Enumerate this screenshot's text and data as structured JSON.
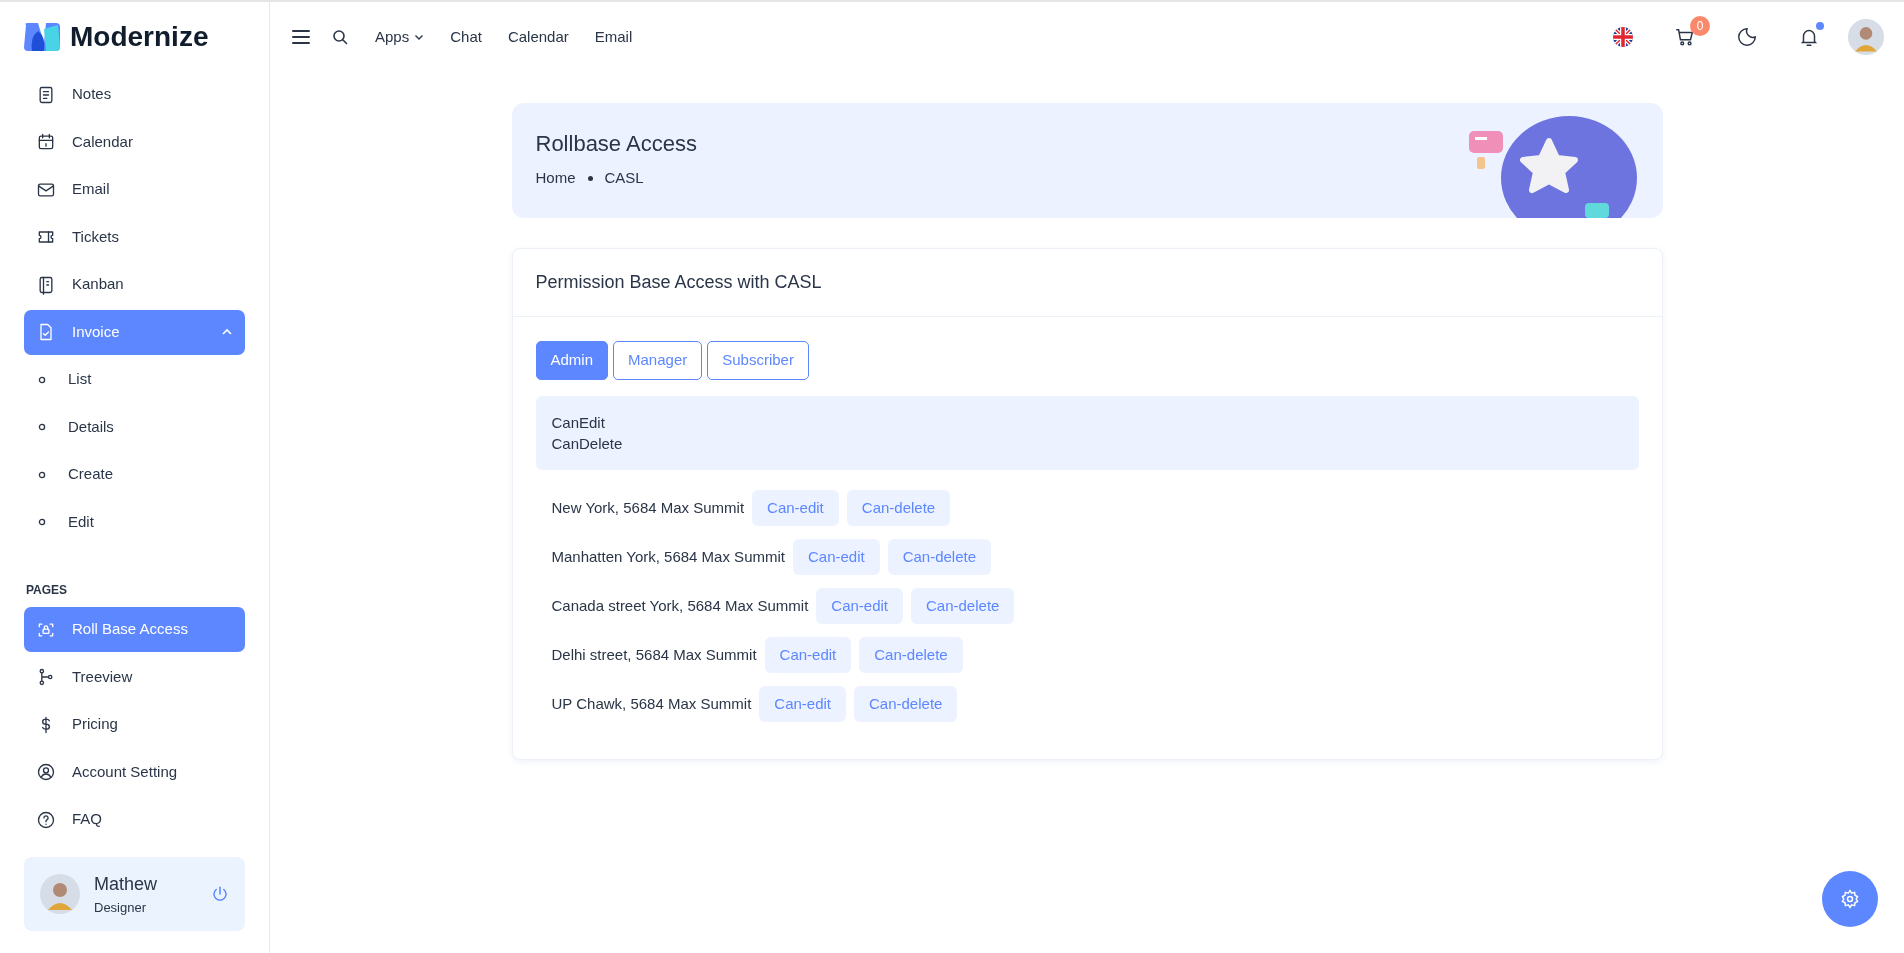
{
  "brand": {
    "name": "Modernize"
  },
  "sidebar": {
    "items": [
      {
        "label": "Notes",
        "selected": false
      },
      {
        "label": "Calendar",
        "selected": false
      },
      {
        "label": "Email",
        "selected": false
      },
      {
        "label": "Tickets",
        "selected": false
      },
      {
        "label": "Kanban",
        "selected": false
      },
      {
        "label": "Invoice",
        "selected": true,
        "expanded": true,
        "children": [
          {
            "label": "List",
            "selected": false
          },
          {
            "label": "Details",
            "selected": false
          },
          {
            "label": "Create",
            "selected": false
          },
          {
            "label": "Edit",
            "selected": false
          }
        ]
      }
    ],
    "section": "PAGES",
    "pages": [
      {
        "label": "Roll Base Access",
        "selected": true
      },
      {
        "label": "Treeview",
        "selected": false
      },
      {
        "label": "Pricing",
        "selected": false
      },
      {
        "label": "Account Setting",
        "selected": false
      },
      {
        "label": "FAQ",
        "selected": false
      }
    ],
    "profile": {
      "name": "Mathew",
      "role": "Designer"
    }
  },
  "topbar": {
    "links": [
      {
        "label": "Apps",
        "dropdown": true
      },
      {
        "label": "Chat",
        "dropdown": false
      },
      {
        "label": "Calendar",
        "dropdown": false
      },
      {
        "label": "Email",
        "dropdown": false
      }
    ],
    "cart_count": "0"
  },
  "header": {
    "title": "Rollbase Access",
    "breadcrumb": [
      "Home",
      "CASL"
    ]
  },
  "card": {
    "title": "Permission Base Access with CASL",
    "roles": [
      {
        "label": "Admin",
        "selected": true
      },
      {
        "label": "Manager",
        "selected": false
      },
      {
        "label": "Subscriber",
        "selected": false
      }
    ],
    "permissions": [
      "CanEdit",
      "CanDelete"
    ],
    "rows": [
      {
        "text": "New York, 5684 Max Summit",
        "actions": [
          "Can-edit",
          "Can-delete"
        ]
      },
      {
        "text": "Manhatten York, 5684 Max Summit",
        "actions": [
          "Can-edit",
          "Can-delete"
        ]
      },
      {
        "text": "Canada street York, 5684 Max Summit",
        "actions": [
          "Can-edit",
          "Can-delete"
        ]
      },
      {
        "text": "Delhi street, 5684 Max Summit",
        "actions": [
          "Can-edit",
          "Can-delete"
        ]
      },
      {
        "text": "UP Chawk, 5684 Max Summit",
        "actions": [
          "Can-edit",
          "Can-delete"
        ]
      }
    ]
  }
}
